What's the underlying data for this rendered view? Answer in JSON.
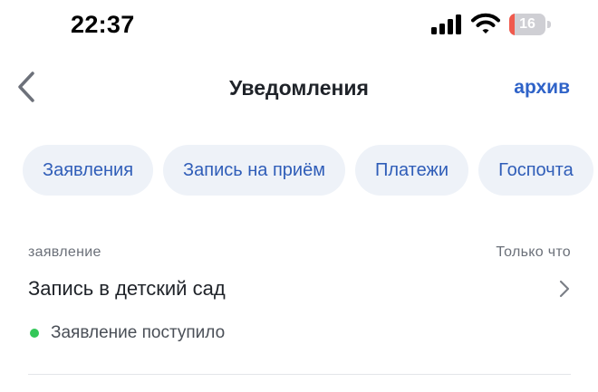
{
  "status_bar": {
    "time": "22:37",
    "battery_level": "16",
    "battery_fraction": 0.16,
    "icons": [
      "signal-icon",
      "wifi-icon",
      "battery-icon"
    ]
  },
  "header": {
    "title": "Уведомления",
    "archive_label": "архив",
    "back_icon": "chevron-left-icon"
  },
  "filters": [
    {
      "label": "Заявления"
    },
    {
      "label": "Запись на приём"
    },
    {
      "label": "Платежи"
    },
    {
      "label": "Госпочта"
    }
  ],
  "notifications": [
    {
      "category": "заявление",
      "time": "Только что",
      "title": "Запись в детский сад",
      "status": "Заявление поступило",
      "status_color": "#34c759"
    }
  ],
  "colors": {
    "accent": "#2f63c8",
    "chip_background": "#eef2f8",
    "battery_low": "#f05a4d",
    "status_ok": "#34c759"
  }
}
